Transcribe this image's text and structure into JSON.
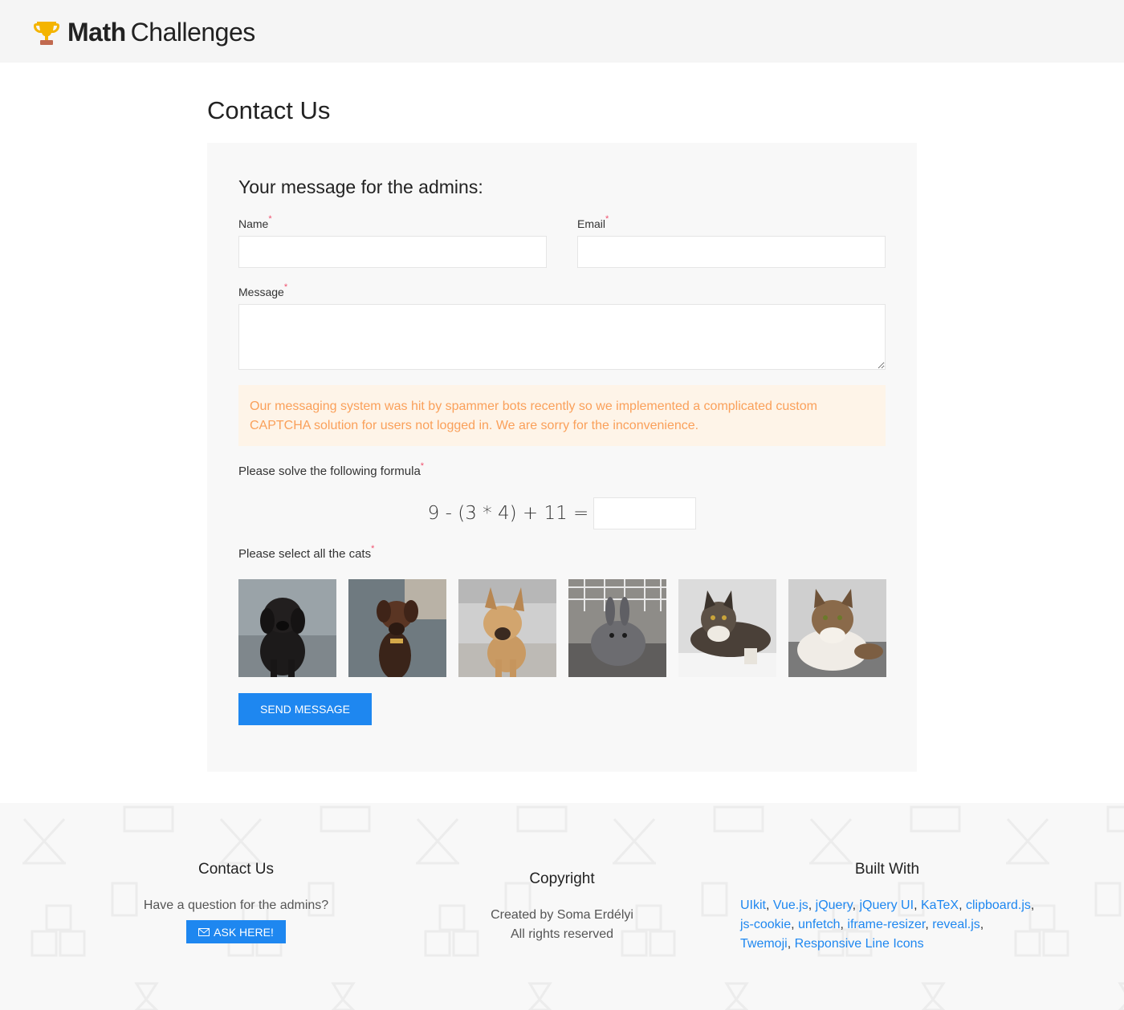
{
  "header": {
    "brand_bold": "Math",
    "brand_regular": "Challenges"
  },
  "page": {
    "title": "Contact Us"
  },
  "form": {
    "heading": "Your message for the admins:",
    "name_label": "Name",
    "email_label": "Email",
    "message_label": "Message",
    "required_mark": "*",
    "notice": "Our messaging system was hit by spammer bots recently so we implemented a complicated custom CAPTCHA solution for users not logged in. We are sorry for the inconvenience.",
    "formula_label": "Please solve the following formula",
    "formula": "9 - (3 * 4) + 11 =",
    "cats_label": "Please select all the cats",
    "photos": [
      "black dog",
      "brown dachshund",
      "tan puppy",
      "grey rabbit",
      "maine coon cat",
      "tabby cat"
    ],
    "submit": "Send Message"
  },
  "footer": {
    "contact_title": "Contact Us",
    "contact_text": "Have a question for the admins?",
    "ask_button": "ASK HERE!",
    "copyright_title": "Copyright",
    "copyright_line1": "Created by Soma Erdélyi",
    "copyright_line2": "All rights reserved",
    "built_title": "Built With",
    "built_links": [
      "UIkit",
      "Vue.js",
      "jQuery",
      "jQuery UI",
      "KaTeX",
      "clipboard.js",
      "js-cookie",
      "unfetch",
      "iframe-resizer",
      "reveal.js",
      "Twemoji",
      "Responsive Line Icons"
    ]
  },
  "colors": {
    "accent": "#1e87f0",
    "warning_text": "#faa05a",
    "warning_bg": "#fef4e8",
    "required": "#f0506e"
  }
}
